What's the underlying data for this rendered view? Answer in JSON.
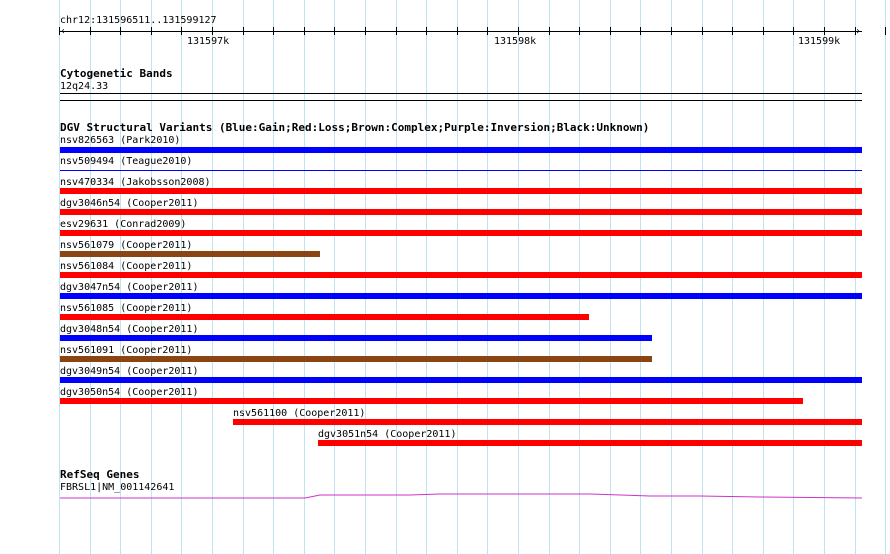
{
  "ruler": {
    "range_label": "chr12:131596511..131599127",
    "ticks": [
      {
        "label": "131597k"
      },
      {
        "label": "131598k"
      },
      {
        "label": "131599k"
      }
    ]
  },
  "cytoband": {
    "title": "Cytogenetic Bands",
    "band": "12q24.33"
  },
  "dgv": {
    "title": "DGV Structural Variants (Blue:Gain;Red:Loss;Brown:Complex;Purple:Inversion;Black:Unknown)",
    "colors": {
      "gain": "#0000ff",
      "loss": "#ff0000",
      "complex": "#8b4513"
    },
    "variants": [
      {
        "label": "nsv826563 (Park2010)",
        "type": "gain"
      },
      {
        "label": "nsv509494 (Teague2010)",
        "type": "gain"
      },
      {
        "label": "nsv470334 (Jakobsson2008)",
        "type": "loss"
      },
      {
        "label": "dgv3046n54 (Cooper2011)",
        "type": "loss"
      },
      {
        "label": "esv29631 (Conrad2009)",
        "type": "loss"
      },
      {
        "label": "nsv561079 (Cooper2011)",
        "type": "complex"
      },
      {
        "label": "nsv561084 (Cooper2011)",
        "type": "loss"
      },
      {
        "label": "dgv3047n54 (Cooper2011)",
        "type": "gain"
      },
      {
        "label": "nsv561085 (Cooper2011)",
        "type": "loss"
      },
      {
        "label": "dgv3048n54 (Cooper2011)",
        "type": "gain"
      },
      {
        "label": "nsv561091 (Cooper2011)",
        "type": "complex"
      },
      {
        "label": "dgv3049n54 (Cooper2011)",
        "type": "gain"
      },
      {
        "label": "dgv3050n54 (Cooper2011)",
        "type": "loss"
      },
      {
        "label": "nsv561100 (Cooper2011)",
        "type": "loss"
      },
      {
        "label": "dgv3051n54 (Cooper2011)",
        "type": "loss"
      }
    ]
  },
  "refseq": {
    "title": "RefSeq Genes",
    "gene": "FBRSL1|NM_001142641",
    "color": "#cc33cc"
  }
}
